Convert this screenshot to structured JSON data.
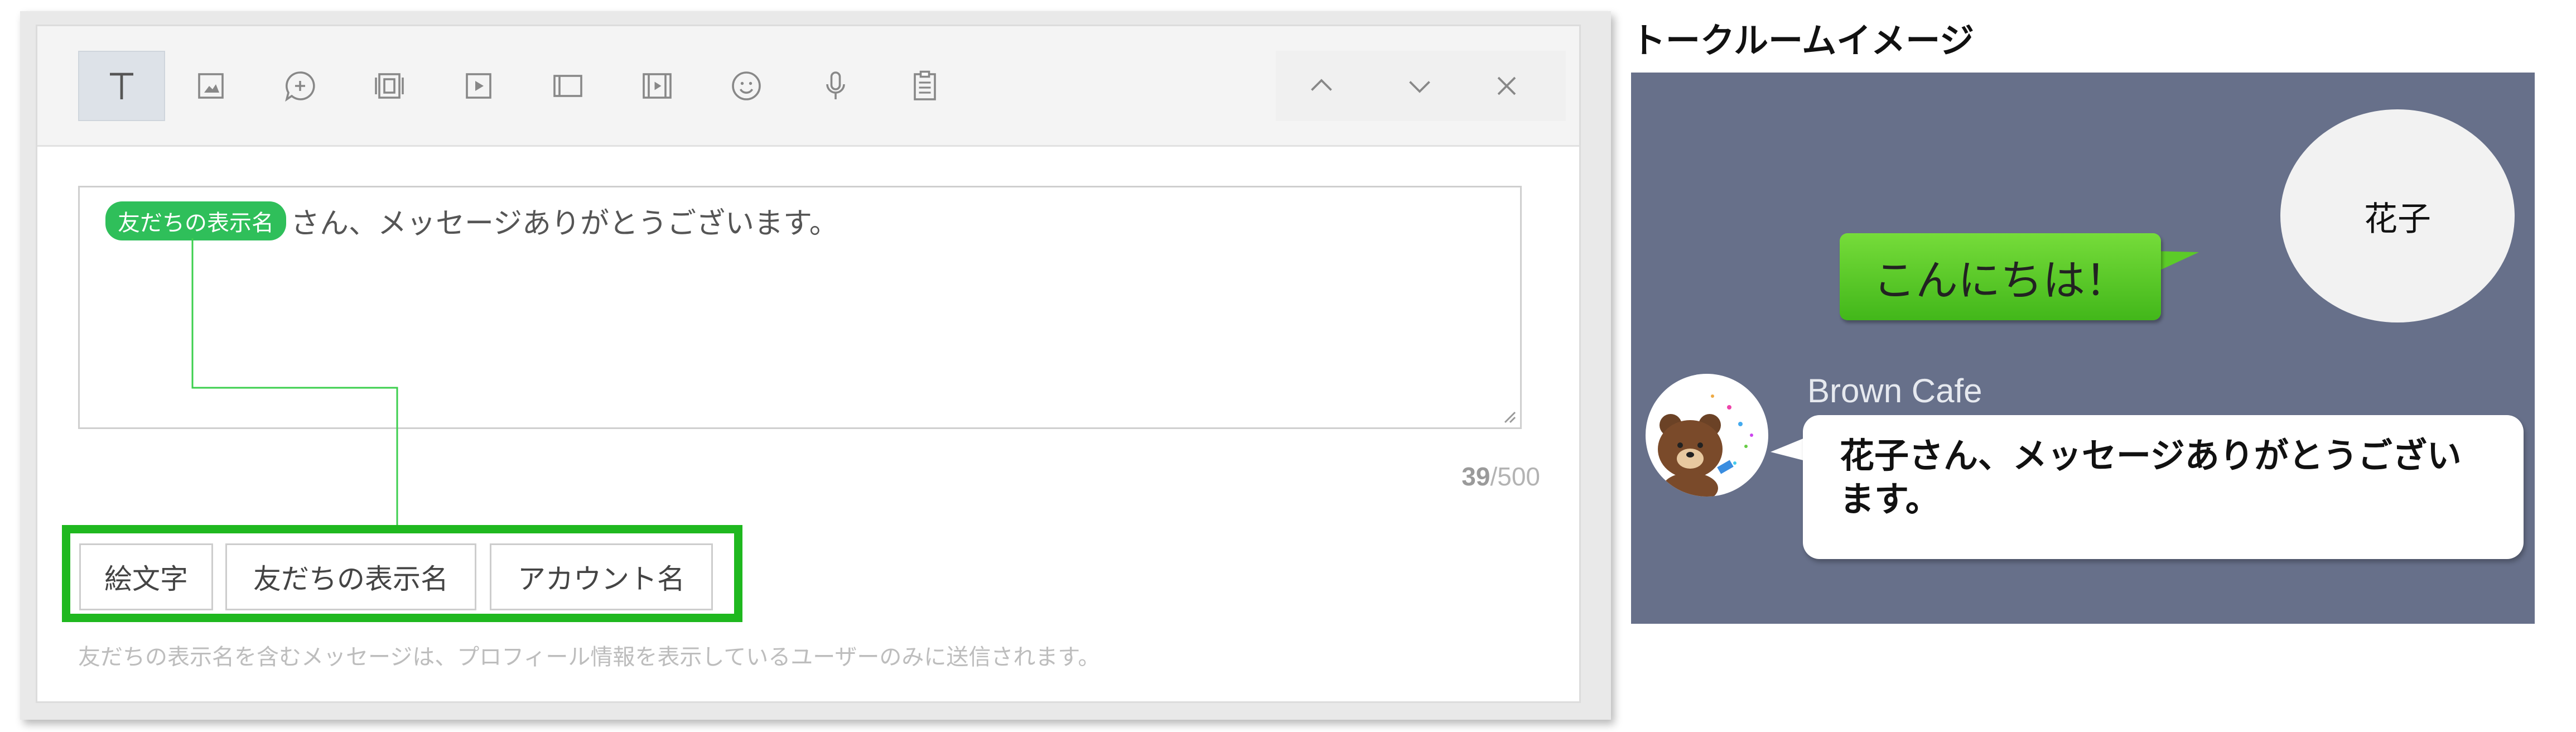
{
  "editor": {
    "toolbar": {
      "tools": [
        {
          "icon": "text-icon",
          "active": true
        },
        {
          "icon": "image-icon"
        },
        {
          "icon": "sticker-icon"
        },
        {
          "icon": "card-message-icon"
        },
        {
          "icon": "video-icon"
        },
        {
          "icon": "rich-message-icon"
        },
        {
          "icon": "rich-video-icon"
        },
        {
          "icon": "emoji-icon"
        },
        {
          "icon": "microphone-icon"
        },
        {
          "icon": "clipboard-icon"
        }
      ],
      "nav": [
        "chevron-up-icon",
        "chevron-down-icon",
        "close-icon"
      ]
    },
    "message": {
      "token_label": "友だちの表示名",
      "text": "さん、メッセージありがとうございます。"
    },
    "counter": {
      "current": "39",
      "separator_max": "/500"
    },
    "insert_buttons": {
      "emoji": "絵文字",
      "friend_name": "友だちの表示名",
      "account_name": "アカウント名"
    },
    "note": "友だちの表示名を含むメッセージは、プロフィール情報を表示しているユーザーのみに送信されます。",
    "colors": {
      "token": "#2fbf5a",
      "highlight_frame": "#1fb81f"
    }
  },
  "preview": {
    "title": "トークルームイメージ",
    "user_name": "花子",
    "user_message": "こんにちは！",
    "bot_name": "Brown Cafe",
    "bot_message": "花子さん、メッセージありがとうございます。",
    "colors": {
      "background": "#67708a",
      "user_bubble": "#5ccb28"
    }
  }
}
